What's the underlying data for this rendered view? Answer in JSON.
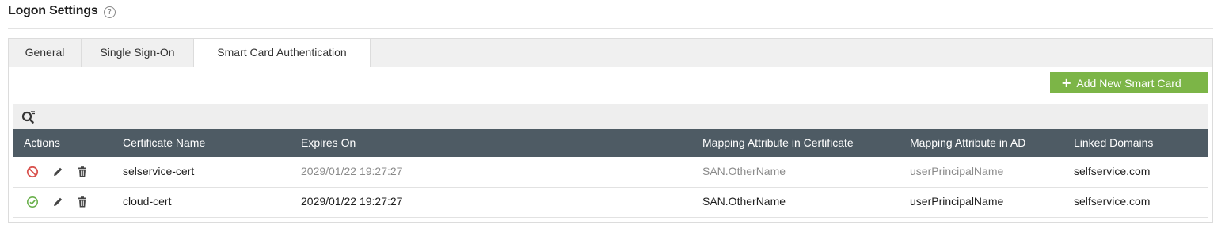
{
  "page": {
    "title": "Logon Settings",
    "help_glyph": "?"
  },
  "tabs": [
    {
      "label": "General",
      "active": false
    },
    {
      "label": "Single Sign-On",
      "active": false
    },
    {
      "label": "Smart Card Authentication",
      "active": true
    }
  ],
  "toolbar": {
    "add_icon": "+",
    "add_label": "Add New Smart Card",
    "add_color": "#7cb547"
  },
  "table": {
    "header_color": "#4e5b64",
    "columns": [
      "Actions",
      "Certificate Name",
      "Expires On",
      "Mapping Attribute in Certificate",
      "Mapping Attribute in AD",
      "Linked Domains"
    ],
    "rows": [
      {
        "status": "disabled",
        "status_icon": "disabled-icon",
        "name": "selservice-cert",
        "expires": "2029/01/22 19:27:27",
        "cert_attr": "SAN.OtherName",
        "ad_attr": "userPrincipalName",
        "domains": "selfservice.com"
      },
      {
        "status": "enabled",
        "status_icon": "enabled-icon",
        "name": "cloud-cert",
        "expires": "2029/01/22 19:27:27",
        "cert_attr": "SAN.OtherName",
        "ad_attr": "userPrincipalName",
        "domains": "selfservice.com"
      }
    ]
  },
  "icons": {
    "search": "search-filter-icon",
    "edit": "pencil-icon",
    "delete": "trash-icon"
  },
  "colors": {
    "disabled": "#d9534f",
    "enabled": "#6ab04c"
  }
}
